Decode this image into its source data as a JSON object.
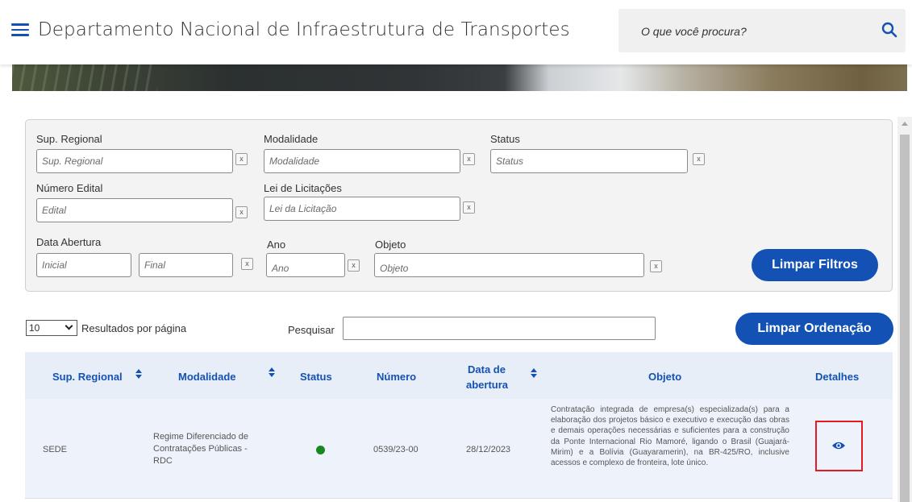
{
  "header": {
    "title": "Departamento Nacional de Infraestrutura de Transportes",
    "search_placeholder": "O que você procura?",
    "accent": "#1351b4"
  },
  "filters": {
    "sup_regional": {
      "label": "Sup. Regional",
      "placeholder": "Sup. Regional"
    },
    "modalidade": {
      "label": "Modalidade",
      "placeholder": "Modalidade"
    },
    "status": {
      "label": "Status",
      "placeholder": "Status"
    },
    "numero_edital": {
      "label": "Número Edital",
      "placeholder": "Edital"
    },
    "lei": {
      "label": "Lei de Licitações",
      "placeholder": "Lei da Licitação"
    },
    "data_abertura": {
      "label": "Data Abertura",
      "placeholder_inicial": "Inicial",
      "placeholder_final": "Final"
    },
    "ano": {
      "label": "Ano",
      "placeholder": "Ano"
    },
    "objeto": {
      "label": "Objeto",
      "placeholder": "Objeto"
    },
    "clear_x": "x",
    "clear_button": "Limpar Filtros"
  },
  "controls": {
    "page_size": "10",
    "page_size_label": "Resultados por página",
    "search_label": "Pesquisar",
    "clear_sort_button": "Limpar Ordenação"
  },
  "table": {
    "columns": {
      "sup_regional": "Sup. Regional",
      "modalidade": "Modalidade",
      "status": "Status",
      "numero": "Número",
      "data_line1": "Data de",
      "data_line2": "abertura",
      "objeto": "Objeto",
      "detalhes": "Detalhes"
    },
    "rows": [
      {
        "sup_regional": "SEDE",
        "modalidade_l1": "Regime Diferenciado de",
        "modalidade_l2": "Contratações Públicas -",
        "modalidade_l3": "RDC",
        "status_color": "#168821",
        "numero": "0539/23-00",
        "data_abertura": "28/12/2023",
        "objeto": "Contratação integrada de empresa(s) especializada(s) para a elaboração dos projetos básico e executivo e execução das obras e demais operações necessárias e suficientes para a construção da Ponte Internacional Rio Mamoré, ligando o Brasil (Guajará-Mirim) e a Bolívia (Guayaramerin), na BR-425/RO, inclusive acessos e complexo de fronteira, lote único."
      }
    ]
  }
}
